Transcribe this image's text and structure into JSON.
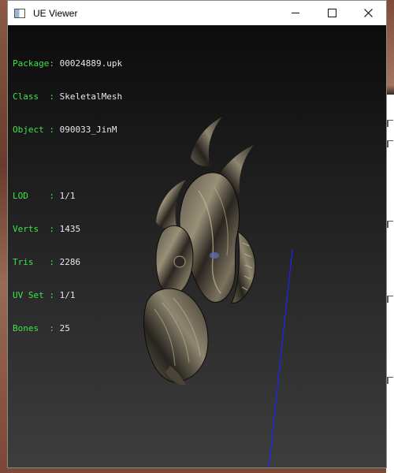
{
  "window": {
    "title": "UE Viewer"
  },
  "info": {
    "package_label": "Package: ",
    "package_value": "00024889.upk",
    "class_label": "Class  : ",
    "class_value": "SkeletalMesh",
    "object_label": "Object : ",
    "object_value": "090033_JinM",
    "lod_label": "LOD    : ",
    "lod_value": "1/1",
    "verts_label": "Verts  : ",
    "verts_value": "1435",
    "tris_label": "Tris   : ",
    "tris_value": "2286",
    "uvset_label": "UV Set : ",
    "uvset_value": "1/1",
    "bones_label": "Bones  : ",
    "bones_value": "25"
  },
  "colors": {
    "label_green": "#3fe34a",
    "axis_blue": "#2020ff"
  },
  "icons": {
    "app": "window-app-icon",
    "minimize": "minimize-icon",
    "maximize": "maximize-icon",
    "close": "close-icon"
  }
}
